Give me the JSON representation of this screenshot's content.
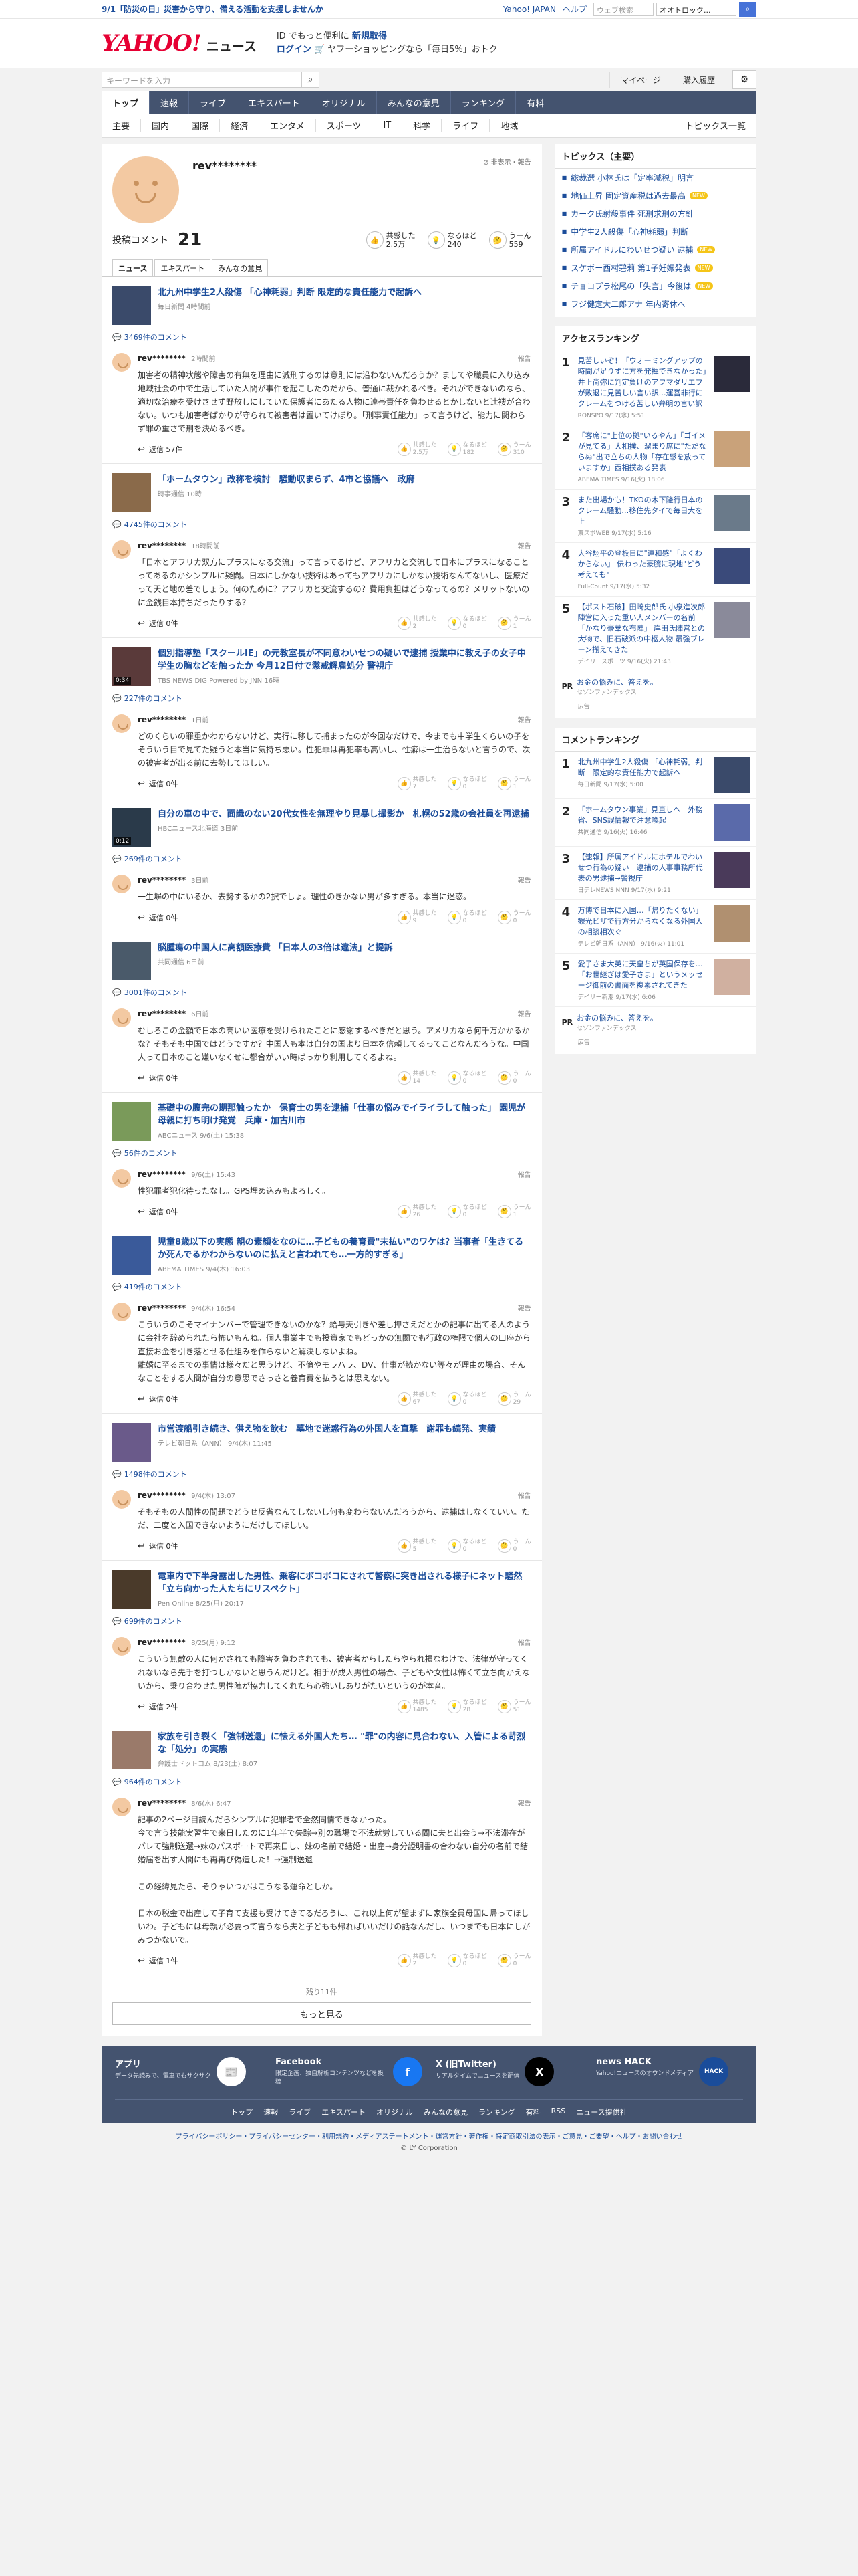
{
  "topbanner": {
    "notice": "9/1「防災の日」災害から守り、備える活動を支援しませんか",
    "yahoo_japan": "Yahoo! JAPAN",
    "help": "ヘルプ",
    "search_placeholder": "ウェブ検索",
    "search_select": "オオトロック...",
    "search_button": "検索"
  },
  "header": {
    "logo": "YAHOO!",
    "logo_sub": "JAPAN",
    "service": "ニュース",
    "promo_a": "ID でもっと便利に",
    "promo_b": "新規取得",
    "login": "ログイン",
    "promo_c": "🛒 ヤフーショッピングなら「毎日5%」おトク"
  },
  "subheader": {
    "search_placeholder": "キーワードを入力",
    "mypage": "マイページ",
    "history": "購入履歴"
  },
  "mainnav": [
    "トップ",
    "速報",
    "ライブ",
    "エキスパート",
    "オリジナル",
    "みんなの意見",
    "ランキング",
    "有料"
  ],
  "catnav": [
    "主要",
    "国内",
    "国際",
    "経済",
    "エンタメ",
    "スポーツ",
    "IT",
    "科学",
    "ライフ",
    "地域"
  ],
  "catnav_list": "トピックス一覧",
  "profile": {
    "name": "rev********",
    "flags": "⊘ 非表示・報告",
    "posts_label": "投稿コメント",
    "posts": "21",
    "rx1_label": "共感した",
    "rx1": "2.5万",
    "rx2_label": "なるほど",
    "rx2": "240",
    "rx3_label": "うーん",
    "rx3": "559"
  },
  "tabs": [
    "ニュース",
    "エキスパート",
    "みんなの意見"
  ],
  "entries": [
    {
      "title": "北九州中学生2人殺傷 「心神耗弱」判断 限定的な責任能力で起訴へ",
      "source": "毎日新聞 4時間前",
      "count": "3469件のコメント",
      "user": "rev********",
      "date": "2時間前",
      "text": "加害者の精神状態や障害の有無を理由に減刑するのは意則には沿わないんだろうか？ましてや職員に入り込み地域社会の中で生活していた人間が事件を起こしたのだから、普通に裁かれるべき。それができないのなら、適切な治療を受けさせず野放しにしていた保護者にあたる人物に連帯責任を負わせるとかしないと辻褄が合わない。いつも加害者ばかりが守られて被害者は置いてけぼり。「刑事責任能力」って言うけど、能力に関わらず罪の重さで刑を決めるべき。",
      "reply": "返信 57件",
      "r1": "2.5万",
      "r2": "182",
      "r3": "310"
    },
    {
      "title": "「ホームタウン」改称を検討　騒動収まらず、4市と協議へ　政府",
      "source": "時事通信 10時",
      "count": "4745件のコメント",
      "user": "rev********",
      "date": "18時間前",
      "text": "「日本とアフリカ双方にプラスになる交流」って言ってるけど、アフリカと交流して日本にプラスになることってあるのかシンプルに疑問。日本にしかない技術はあってもアフリカにしかない技術なんてないし、医療だって天と地の差でしょう。何のために？アフリカと交流するの？費用負担はどうなってるの？メリットないのに金銭目本持ちだったりする？",
      "reply": "返信 0件",
      "r1": "2",
      "r2": "0",
      "r3": "1"
    },
    {
      "title": "個別指導塾「スクールIE」の元教室長が不同意わいせつの疑いで逮捕 授業中に教え子の女子中学生の胸などを触ったか 今月12日付で懲戒解雇処分 警視庁",
      "source": "TBS NEWS DIG Powered by JNN 16時",
      "count": "227件のコメント",
      "user": "rev********",
      "date": "1日前",
      "text": "どのくらいの罪重かわからないけど、実行に移して捕まったのが今回なだけで、今までも中学生くらいの子をそういう目で見てた疑うと本当に気持ち悪い。性犯罪は再犯率も高いし、性癖は一生治らないと言うので、次の被害者が出る前に去勢してほしい。",
      "reply": "返信 0件",
      "r1": "7",
      "r2": "0",
      "r3": "1",
      "video": "0:34"
    },
    {
      "title": "自分の車の中で、面識のない20代女性を無理やり見暴し撮影か　札幌の52歳の会社員を再逮捕",
      "source": "HBCニュース北海道 3日前",
      "count": "269件のコメント",
      "user": "rev********",
      "date": "3日前",
      "text": "一生塀の中にいるか、去勢するかの2択でしょ。理性のきかない男が多すぎる。本当に迷惑。",
      "reply": "返信 0件",
      "r1": "9",
      "r2": "0",
      "r3": "0",
      "video": "0:12"
    },
    {
      "title": "脳腫瘍の中国人に高額医療費 「日本人の3倍は違法」と提訴",
      "source": "共同通信 6日前",
      "count": "3001件のコメント",
      "user": "rev********",
      "date": "6日前",
      "text": "むしろこの金額で日本の高いい医療を受けられたことに感謝するべきだと思う。アメリカなら何千万かかるかな？そもそも中国ではどうですか？中国人も本は自分の国より日本を信頼してるってことなんだろうな。中国人って日本のこと嫌いなくせに都合がいい時ばっかり利用してくるよね。",
      "reply": "返信 0件",
      "r1": "14",
      "r2": "0",
      "r3": "0"
    },
    {
      "title": "基礎中の腹完の期那触ったか　保育士の男を逮捕「仕事の悩みでイライラして触った」 園児が母親に打ち明け発覚　兵庫・加古川市",
      "source": "ABCニュース 9/6(土) 15:38",
      "count": "56件のコメント",
      "user": "rev********",
      "date": "9/6(土) 15:43",
      "text": "性犯罪者犯化待ったなし。GPS埋め込みもよろしく。",
      "reply": "返信 0件",
      "r1": "26",
      "r2": "0",
      "r3": "1"
    },
    {
      "title": "児童8歳以下の実態 親の素顔をなのに…子どもの養育費\"未払い\"のワケは？当事者「生きてるか死んでるかわからないのに払えと言われても…一方的すぎる」",
      "source": "ABEMA TIMES 9/4(木) 16:03",
      "count": "419件のコメント",
      "user": "rev********",
      "date": "9/4(木) 16:54",
      "text": "こういうのこそマイナンバーで管理できないのかな？給与天引きや差し押さえだとかの記事に出てる人のように会社を辞められたら怖いもんね。個人事業主でも投資家でもどっかの無関でも行政の権限で個人の口座から直接お金を引き落とせる仕組みを作らないと解決しないよね。\n離婚に至るまでの事情は様々だと思うけど、不倫やモラハラ、DV、仕事が続かない等々が理由の場合、そんなことをする人間が自分の意思でさっさと養育費を払うとは思えない。",
      "reply": "返信 0件",
      "r1": "67",
      "r2": "0",
      "r3": "29"
    },
    {
      "title": "市営渡船引き続き、供え物を飲む　墓地で迷惑行為の外国人を直撃　謝罪も続発、実績",
      "source": "テレビ朝日系（ANN） 9/4(木) 11:45",
      "count": "1498件のコメント",
      "user": "rev********",
      "date": "9/4(木) 13:07",
      "text": "そもそもの人間性の問題でどうせ反省なんてしないし何も変わらないんだろうから、逮捕はしなくていい。ただ、二度と入国できないようにだけしてほしい。",
      "reply": "返信 0件",
      "r1": "5",
      "r2": "0",
      "r3": "0"
    },
    {
      "title": "電車内で下半身露出した男性、乗客にボコボコにされて警察に突き出される様子にネット騒然「立ち向かった人たちにリスペクト」",
      "source": "Pen Online 8/25(月) 20:17",
      "count": "699件のコメント",
      "user": "rev********",
      "date": "8/25(月) 9:12",
      "text": "こういう無敵の人に何かされても障害を負わされても、被害者からしたらやられ損なわけで、法律が守ってくれないなら先手を打つしかないと思うんだけど。相手が成人男性の場合、子どもや女性は怖くて立ち向かえないから、乗り合わせた男性陣が協力してくれたら心強いしありがたいというのが本音。",
      "reply": "返信 2件",
      "r1": "1485",
      "r2": "28",
      "r3": "51"
    },
    {
      "title": "家族を引き裂く「強制送還」に怯える外国人たち… \"罪\"の内容に見合わない、入管による苛烈な「処分」の実態",
      "source": "弁護士ドットコム 8/23(土) 8:07",
      "count": "964件のコメント",
      "user": "rev********",
      "date": "8/6(水) 6:47",
      "text": "記事の2ページ目読んだらシンプルに犯罪者で全然同情できなかった。\n今で言う技能実習生で来日したのに1年半で失踪→別の職場で不法就労している間に夫と出会う→不法滞在がバレて強制送還→妹のパスポートで再来日し、妹の名前で結婚・出産→身分證明書の合わない自分の名前で結婚届を出す人間にも再再び偽造した！→強制送還\n\nこの経緯見たら、そりゃいつかはこうなる運命としか。\n\n日本の税金で出産して子育て支援も受けてきてるだろうに、これ以上何が望まずに家族全員母国に帰ってほしいわ。子どもには母親が必要って言うなら夫と子どもも帰ればいいだけの話なんだし、いつまでも日本にしがみつかないで。",
      "reply": "返信 1件",
      "r1": "2",
      "r2": "0",
      "r3": "0"
    }
  ],
  "more": {
    "remaining": "残り11件",
    "button": "もっと見る"
  },
  "sidebar": {
    "topics_title": "トピックス（主要）",
    "topics": [
      {
        "t": "総裁選 小林氏は「定率減税」明言",
        "b": ""
      },
      {
        "t": "地価上昇 固定資産税は過去最高",
        "b": "NEW"
      },
      {
        "t": "カーク氏射殺事件 死刑求刑の方針",
        "b": ""
      },
      {
        "t": "中学生2人殺傷「心神耗弱」判断",
        "b": ""
      },
      {
        "t": "所属アイドルにわいせつ疑い 逮捕",
        "b": "NEW"
      },
      {
        "t": "スケボー西村碧莉 第1子妊娠発表",
        "b": "NEW"
      },
      {
        "t": "チョコプラ松尾の「失言」今後は",
        "b": "NEW"
      },
      {
        "t": "フジ健定大二郎アナ 年内寄休へ",
        "b": ""
      }
    ],
    "access_title": "アクセスランキング",
    "access": [
      {
        "no": "1",
        "t": "見苦しいぞ！「ウォーミングアップの時間が足りずに方を発揮できなかった」井上尚弥に判定負けのアフマダリエフが敗退に見苦しい言い訳…運営非行にクレームをつける苦しい弁明の言い訳",
        "s": "RONSPO 9/17(水) 5:51"
      },
      {
        "no": "2",
        "t": "「客席に\"上位の拠\"いるやん」「ゴイメが見てる」大相撲、溜まり席に\"ただならぬ\"出で立ちの人物「存在感を放っていますか」西相撲ある発表",
        "s": "ABEMA TIMES 9/16(火) 18:06"
      },
      {
        "no": "3",
        "t": "また出場かも！TKOの木下隆行日本のクレーム騒動…移住先タイで毎日大を上",
        "s": "東スポWEB 9/17(水) 5:16"
      },
      {
        "no": "4",
        "t": "大谷翔平の登板日に\"連和感\"「よくわからない」 伝わった豪腕に現地\"どう考えても\"",
        "s": "Full-Count 9/17(水) 5:32"
      },
      {
        "no": "5",
        "t": "【ポスト石破】田崎史郎氏 小泉進次郎陣営に入った重い人メンバーの名前「かなり豪華な布陣」 岸田氏陣営との大物で、旧石破派の中枢人物 最強ブレーン揃えてきた",
        "s": "デイリースポーツ 9/16(火) 21:43"
      }
    ],
    "pr_label": "PR",
    "pr_text": "お金の悩みに、答えを。",
    "pr_src": "セゾンファンデックス",
    "pr_adv": "広告",
    "comment_title": "コメントランキング",
    "comment": [
      {
        "no": "1",
        "t": "北九州中学生2人殺傷 「心神耗弱」判断　限定的な責任能力で起訴へ",
        "s": "毎日新聞 9/17(水) 5:00"
      },
      {
        "no": "2",
        "t": "「ホームタウン事業」見直しへ　外務省、SNS誤情報で注意喚起",
        "s": "共同通信 9/16(火) 16:46"
      },
      {
        "no": "3",
        "t": "【速報】所属アイドルにホテルでわいせつ行為の疑い　逮捕の人事事務所代表の男逮捕→警視庁",
        "s": "日テレNEWS NNN 9/17(水) 9:21"
      },
      {
        "no": "4",
        "t": "万博で日本に入国…「帰りたくない」観光ビザで行方分からなくなる外国人の相談相次ぐ",
        "s": "テレビ朝日系（ANN） 9/16(火) 11:01"
      },
      {
        "no": "5",
        "t": "愛子さま大英に天皇ちが英国保存を…「お世継ぎは愛子さま」というメッセージ御前の書面を複素されてきた",
        "s": "デイリー新潮 9/17(水) 6:06"
      }
    ]
  },
  "footer": {
    "apps": [
      {
        "h": "アプリ",
        "d": "データ先読みで、電車でもサクサク",
        "ic": "📰"
      },
      {
        "h": "Facebook",
        "d": "限定企画、独自解析コンテンツなどを投稿",
        "ic": "f"
      },
      {
        "h": "X (旧Twitter)",
        "d": "リアルタイムでニュースを配信",
        "ic": "X"
      },
      {
        "h": "news HACK",
        "d": "Yahoo!ニュースのオウンドメディア",
        "ic": "HACK"
      }
    ],
    "nav": [
      "トップ",
      "速報",
      "ライブ",
      "エキスパート",
      "オリジナル",
      "みんなの意見",
      "ランキング",
      "有料",
      "RSS",
      "ニュース提供社"
    ],
    "legal": "プライバシーポリシー・プライバシーセンター・利用規約・メディアステートメント・運営方針・著作権・特定商取引法の表示・ご意見・ご要望・ヘルプ・お問い合わせ",
    "copyright": "© LY Corporation"
  }
}
